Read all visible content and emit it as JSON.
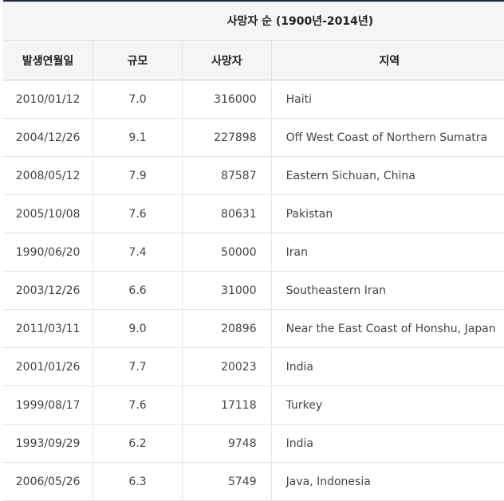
{
  "caption": "사망자 순 (1900년-2014년)",
  "columns": [
    "발생연월일",
    "규모",
    "사망자",
    "지역"
  ],
  "rows": [
    {
      "date": "2010/01/12",
      "magnitude": "7.0",
      "deaths": "316000",
      "region": "Haiti"
    },
    {
      "date": "2004/12/26",
      "magnitude": "9.1",
      "deaths": "227898",
      "region": "Off West Coast of Northern Sumatra"
    },
    {
      "date": "2008/05/12",
      "magnitude": "7.9",
      "deaths": "87587",
      "region": "Eastern Sichuan, China"
    },
    {
      "date": "2005/10/08",
      "magnitude": "7.6",
      "deaths": "80631",
      "region": "Pakistan"
    },
    {
      "date": "1990/06/20",
      "magnitude": "7.4",
      "deaths": "50000",
      "region": "Iran"
    },
    {
      "date": "2003/12/26",
      "magnitude": "6.6",
      "deaths": "31000",
      "region": "Southeastern Iran"
    },
    {
      "date": "2011/03/11",
      "magnitude": "9.0",
      "deaths": "20896",
      "region": "Near the East Coast of Honshu, Japan"
    },
    {
      "date": "2001/01/26",
      "magnitude": "7.7",
      "deaths": "20023",
      "region": "India"
    },
    {
      "date": "1999/08/17",
      "magnitude": "7.6",
      "deaths": "17118",
      "region": "Turkey"
    },
    {
      "date": "1993/09/29",
      "magnitude": "6.2",
      "deaths": "9748",
      "region": "India"
    },
    {
      "date": "2006/05/26",
      "magnitude": "6.3",
      "deaths": "5749",
      "region": "Java, Indonesia"
    }
  ],
  "colors": {
    "header_bg": "#f5f5f5",
    "top_rule": "#1f2b3a",
    "grid": "#e4e4e4"
  }
}
